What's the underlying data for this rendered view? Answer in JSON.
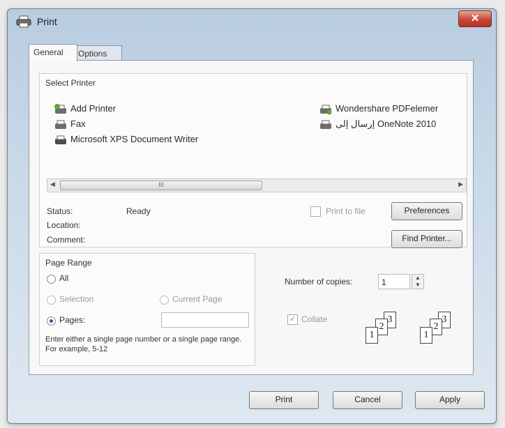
{
  "window": {
    "title": "Print"
  },
  "tabs": [
    {
      "label": "General"
    },
    {
      "label": "Options"
    }
  ],
  "select_printer": {
    "title": "Select Printer",
    "printers_left": [
      {
        "label": "Add Printer",
        "icon": "add-printer-icon"
      },
      {
        "label": "Fax",
        "icon": "fax-icon"
      },
      {
        "label": "Microsoft XPS Document Writer",
        "icon": "printer-icon"
      }
    ],
    "printers_right": [
      {
        "label": "Wondershare PDFelemer",
        "icon": "printer-icon"
      },
      {
        "label": "إرسال إلى OneNote 2010",
        "icon": "printer-icon"
      }
    ],
    "scroll_mark": "III",
    "status_label": "Status:",
    "status_value": "Ready",
    "location_label": "Location:",
    "comment_label": "Comment:",
    "print_to_file_label": "Print to file",
    "preferences_label": "Preferences",
    "find_printer_label": "Find Printer..."
  },
  "page_range": {
    "title": "Page Range",
    "all_label": "All",
    "selection_label": "Selection",
    "current_page_label": "Current Page",
    "pages_label": "Pages:",
    "pages_value": "",
    "help_text": "Enter either a single page number or a single page range.  For example, 5-12"
  },
  "copies": {
    "number_label": "Number of copies:",
    "number_value": "1",
    "collate_label": "Collate",
    "collate_digits": [
      "1",
      "2",
      "3"
    ]
  },
  "buttons": {
    "print": "Print",
    "cancel": "Cancel",
    "apply": "Apply"
  }
}
